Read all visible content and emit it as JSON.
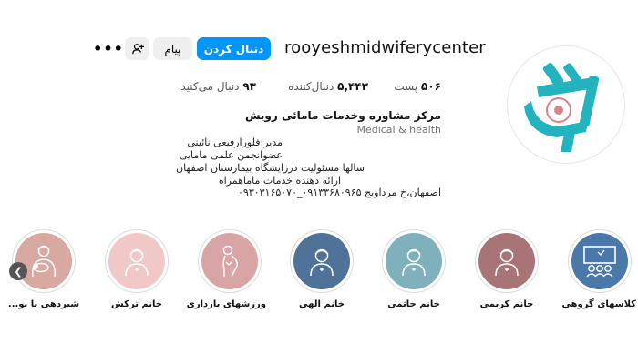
{
  "profile": {
    "username": "rooyeshmidwiferycenter",
    "follow_label": "دنبال کردن",
    "message_label": "پیام",
    "more_label": "•••"
  },
  "stats": {
    "posts_value": "۵۰۶",
    "posts_label": "پست",
    "followers_value": "۵,۴۴۳",
    "followers_label": "دنبال‌کننده",
    "following_value": "۹۳",
    "following_label": "دنبال می‌کنید"
  },
  "bio": {
    "name": "مرکز مشاوره وخدمات مامائی رویش",
    "category": "Medical & health",
    "lines": [
      "مدیر:فلورارفیعی نائینی",
      "عضوانجمن علمی مامایی",
      "سالها مسئولیت درزایشگاه بیمارستان اصفهان",
      "ارائه دهنده خدمات ماماهمراه",
      "اصفهان،خ مرداویج ۰۹۱۳۳۶۸۰۹۶۵_۰۹۳۰۳۱۶۵۰۷۰"
    ]
  },
  "highlights": [
    {
      "label": "کلاسهای گروهی",
      "color": "#4a78a8",
      "icon": "group-class-icon"
    },
    {
      "label": "خانم کریمی",
      "color": "#a87478",
      "icon": "nurse-icon"
    },
    {
      "label": "خانم حاتمی",
      "color": "#7fb0bb",
      "icon": "nurse-icon"
    },
    {
      "label": "خانم الهی",
      "color": "#4f7299",
      "icon": "nurse-icon"
    },
    {
      "label": "ورزشهای بارداری",
      "color": "#d9a4a6",
      "icon": "pregnant-icon"
    },
    {
      "label": "خانم ترکش",
      "color": "#f1c8c8",
      "icon": "nurse-icon"
    },
    {
      "label": "شیردهی با نو...",
      "color": "#d7a9a0",
      "icon": "breastfeeding-icon"
    }
  ],
  "colors": {
    "accent": "#0095f6",
    "logo": "#23b3bf"
  }
}
